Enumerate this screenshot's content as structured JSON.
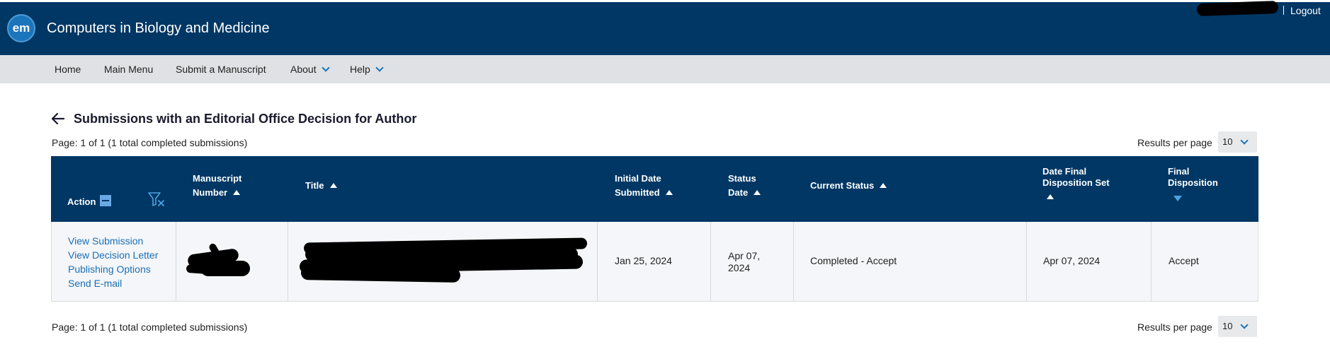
{
  "header": {
    "logo_text": "em",
    "journal_title": "Computers in Biology and Medicine",
    "logout_label": "Logout"
  },
  "nav": {
    "items": [
      {
        "label": "Home"
      },
      {
        "label": "Main Menu"
      },
      {
        "label": "Submit a Manuscript"
      },
      {
        "label": "About",
        "dropdown": true
      },
      {
        "label": "Help",
        "dropdown": true
      }
    ]
  },
  "page": {
    "title": "Submissions with an Editorial Office Decision for Author",
    "pager_top": "Page: 1 of 1 (1 total completed submissions)",
    "pager_bottom": "Page: 1 of 1 (1 total completed submissions)",
    "results_per_page_label": "Results per page",
    "results_per_page_value": "10"
  },
  "table": {
    "headers": {
      "action": "Action",
      "manuscript_number_1": "Manuscript",
      "manuscript_number_2": "Number",
      "title": "Title",
      "initial_date_1": "Initial Date",
      "initial_date_2": "Submitted",
      "status_date_1": "Status",
      "status_date_2": "Date",
      "current_status": "Current Status",
      "date_final_1": "Date Final",
      "date_final_2": "Disposition Set",
      "final_disposition_1": "Final",
      "final_disposition_2": "Disposition"
    },
    "rows": [
      {
        "actions": [
          "View Submission",
          "View Decision Letter",
          "Publishing Options",
          "Send E-mail"
        ],
        "initial_date": "Jan 25, 2024",
        "status_date_1": "Apr 07,",
        "status_date_2": "2024",
        "current_status": "Completed - Accept",
        "date_final_disposition": "Apr 07, 2024",
        "final_disposition": "Accept"
      }
    ]
  },
  "colors": {
    "header_blue": "#003764",
    "link_blue": "#1b6fb3",
    "nav_gray": "#dfe1e4",
    "row_bg": "#f4f6f9"
  }
}
